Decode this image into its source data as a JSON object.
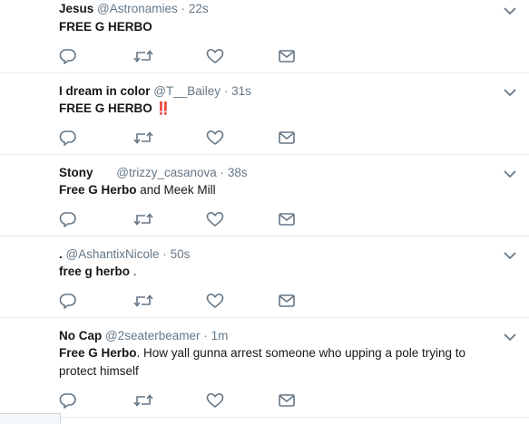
{
  "tweets": [
    {
      "name": "Jesus",
      "handle": "@Astronamies",
      "time": "22s",
      "body_bold": "FREE G HERBO",
      "body_rest": "",
      "emoji": ""
    },
    {
      "name": "I dream in color",
      "handle": "@T__Bailey",
      "time": "31s",
      "body_bold": "FREE G HERBO",
      "body_rest": "",
      "emoji": "‼️"
    },
    {
      "name": "Stony",
      "handle": "@trizzy_casanova",
      "time": "38s",
      "body_bold": "Free G Herbo",
      "body_rest": " and Meek Mill",
      "emoji": ""
    },
    {
      "name": ".",
      "handle": "@AshantixNicole",
      "time": "50s",
      "body_bold": "free g herbo",
      "body_rest": " .",
      "emoji": ""
    },
    {
      "name": "No Cap",
      "handle": "@2seaterbeamer",
      "time": "1m",
      "body_bold": "Free G Herbo",
      "body_rest": ". How yall gunna arrest someone who upping a pole trying to protect himself",
      "emoji": ""
    }
  ],
  "separator": "·",
  "icons": {
    "reply": "reply-icon",
    "retweet": "retweet-icon",
    "like": "heart-icon",
    "dm": "envelope-icon",
    "caret": "chevron-down-icon"
  },
  "colors": {
    "text": "#14171a",
    "muted": "#657786",
    "icon": "#657786",
    "divider": "#e6ecf0",
    "emoji": "#e0245e"
  }
}
